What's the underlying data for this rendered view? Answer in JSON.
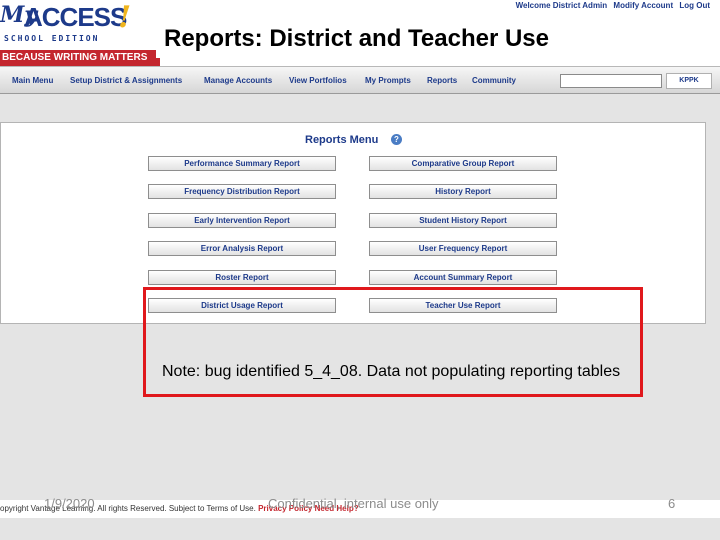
{
  "logo": {
    "my": "My",
    "access": "ACCESS",
    "exclaim": "!",
    "edition": "SCHOOL EDITION",
    "tagline": "BECAUSE WRITING MATTERS"
  },
  "top_links": {
    "welcome": "Welcome District Admin",
    "modify_account": "Modify Account",
    "log_out": "Log Out"
  },
  "slide_title": "Reports: District and Teacher Use",
  "nav": {
    "items": [
      "Main Menu",
      "Setup District & Assignments",
      "Manage Accounts",
      "View Portfolios",
      "My Prompts",
      "Reports",
      "Community"
    ],
    "search_value": "",
    "badge": "KPPK"
  },
  "reports_menu": {
    "title": "Reports Menu",
    "help_icon": "?",
    "left_buttons": [
      "Performance Summary Report",
      "Frequency Distribution Report",
      "Early Intervention Report",
      "Error Analysis Report",
      "Roster Report",
      "District Usage Report"
    ],
    "right_buttons": [
      "Comparative Group Report",
      "History Report",
      "Student History Report",
      "User Frequency Report",
      "Account Summary Report",
      "Teacher Use Report"
    ]
  },
  "annotation": {
    "note": "Note: bug identified 5_4_08.  Data not populating reporting tables",
    "highlight_color": "#e0181c"
  },
  "footer": {
    "copyright_text": "opyright Vantage Learning. All rights Reserved. Subject to Terms of Use.",
    "privacy_policy": "Privacy Policy",
    "need_help": "Need Help?",
    "date": "1/9/2020",
    "center": "Confidential, internal use only",
    "page": "6"
  },
  "colors": {
    "brand_blue": "#1d3a8a",
    "brand_red": "#c4262e",
    "accent_yellow": "#f0b51e"
  }
}
